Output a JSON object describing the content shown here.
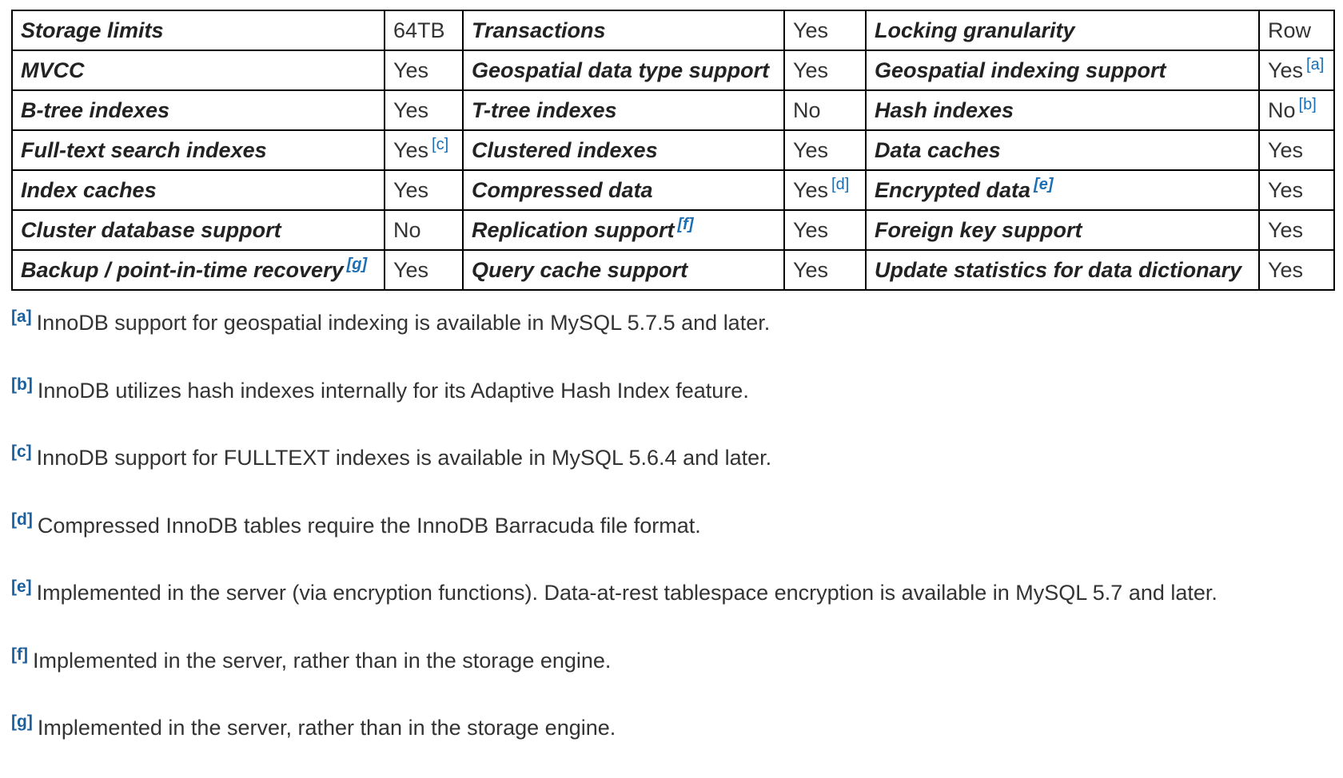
{
  "table": {
    "rows": [
      [
        {
          "feature": "Storage limits",
          "value": "64TB"
        },
        {
          "feature": "Transactions",
          "value": "Yes"
        },
        {
          "feature": "Locking granularity",
          "value": "Row"
        }
      ],
      [
        {
          "feature": "MVCC",
          "value": "Yes"
        },
        {
          "feature": "Geospatial data type support",
          "value": "Yes"
        },
        {
          "feature": "Geospatial indexing support",
          "value": "Yes",
          "value_note": "[a]"
        }
      ],
      [
        {
          "feature": "B-tree indexes",
          "value": "Yes"
        },
        {
          "feature": "T-tree indexes",
          "value": "No"
        },
        {
          "feature": "Hash indexes",
          "value": "No",
          "value_note": "[b]"
        }
      ],
      [
        {
          "feature": "Full-text search indexes",
          "value": "Yes",
          "value_note": "[c]"
        },
        {
          "feature": "Clustered indexes",
          "value": "Yes"
        },
        {
          "feature": "Data caches",
          "value": "Yes"
        }
      ],
      [
        {
          "feature": "Index caches",
          "value": "Yes"
        },
        {
          "feature": "Compressed data",
          "value": "Yes",
          "value_note": "[d]"
        },
        {
          "feature": "Encrypted data",
          "feature_note": "[e]",
          "value": "Yes"
        }
      ],
      [
        {
          "feature": "Cluster database support",
          "value": "No"
        },
        {
          "feature": "Replication support",
          "feature_note": "[f]",
          "value": "Yes"
        },
        {
          "feature": "Foreign key support",
          "value": "Yes"
        }
      ],
      [
        {
          "feature": "Backup / point-in-time recovery",
          "feature_note": "[g]",
          "value": "Yes"
        },
        {
          "feature": "Query cache support",
          "value": "Yes"
        },
        {
          "feature": "Update statistics for data dictionary",
          "value": "Yes"
        }
      ]
    ]
  },
  "footnotes": [
    {
      "mark": "[a]",
      "text": "InnoDB support for geospatial indexing is available in MySQL 5.7.5 and later."
    },
    {
      "mark": "[b]",
      "text": "InnoDB utilizes hash indexes internally for its Adaptive Hash Index feature."
    },
    {
      "mark": "[c]",
      "text": "InnoDB support for FULLTEXT indexes is available in MySQL 5.6.4 and later."
    },
    {
      "mark": "[d]",
      "text": "Compressed InnoDB tables require the InnoDB Barracuda file format."
    },
    {
      "mark": "[e]",
      "text": "Implemented in the server (via encryption functions). Data-at-rest tablespace encryption is available in MySQL 5.7 and later."
    },
    {
      "mark": "[f]",
      "text": "Implemented in the server, rather than in the storage engine."
    },
    {
      "mark": "[g]",
      "text": "Implemented in the server, rather than in the storage engine."
    }
  ],
  "colors": {
    "link": "#1a6fb5",
    "border": "#000000",
    "text": "#333333"
  }
}
